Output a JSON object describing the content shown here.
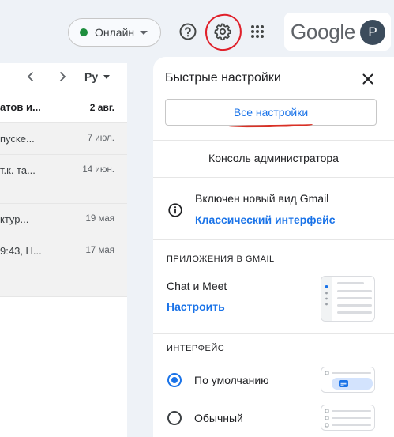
{
  "topbar": {
    "status_label": "Онлайн",
    "status_color": "#1e8e3e",
    "help_icon": "help-circle-icon",
    "settings_icon": "gear-icon",
    "apps_icon": "apps-grid-icon",
    "brand_text": "Google",
    "avatar_initial": "P"
  },
  "mail_list": {
    "lang_label": "Ру",
    "rows": [
      {
        "snippet": "атов и...",
        "date": "2 авг.",
        "unread": true
      },
      {
        "snippet": "пуске...",
        "date": "7 июл.",
        "unread": false
      },
      {
        "snippet": "т.к. та...",
        "date": "14 июн.",
        "unread": false
      },
      {
        "snippet": "ктур...",
        "date": "19 мая",
        "unread": false
      },
      {
        "snippet": "9:43, Н...",
        "date": "17 мая",
        "unread": false
      }
    ]
  },
  "quick_settings": {
    "title": "Быстрые настройки",
    "all_settings": "Все настройки",
    "admin_console": "Консоль администратора",
    "new_view_text": "Включен новый вид Gmail",
    "classic_link": "Классический интерфейс",
    "apps_section": "ПРИЛОЖЕНИЯ В GMAIL",
    "chat_meet": "Chat и Meet",
    "configure": "Настроить",
    "interface_section": "ИНТЕРФЕЙС",
    "density_options": [
      {
        "label": "По умолчанию",
        "checked": true
      },
      {
        "label": "Обычный",
        "checked": false
      }
    ]
  },
  "colors": {
    "accent": "#1a73e8",
    "annotation": "#d93025",
    "background": "#eef2f7"
  }
}
